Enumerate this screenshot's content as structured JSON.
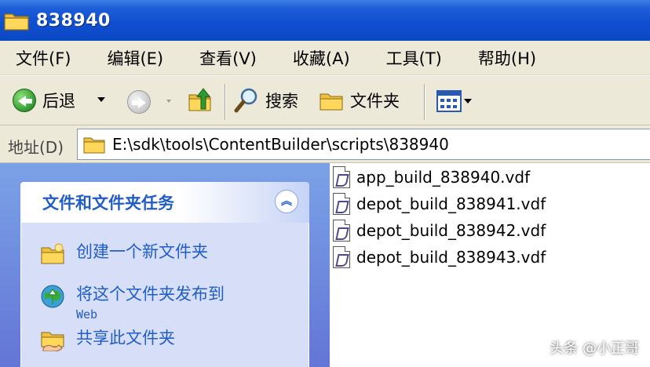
{
  "window": {
    "title": "838940"
  },
  "menu": [
    {
      "label": "文件(F)"
    },
    {
      "label": "编辑(E)"
    },
    {
      "label": "查看(V)"
    },
    {
      "label": "收藏(A)"
    },
    {
      "label": "工具(T)"
    },
    {
      "label": "帮助(H)"
    }
  ],
  "toolbar": {
    "back_label": "后退",
    "search_label": "搜索",
    "folders_label": "文件夹"
  },
  "address": {
    "label": "地址(D)",
    "path": "E:\\sdk\\tools\\ContentBuilder\\scripts\\838940"
  },
  "tasks": {
    "header": "文件和文件夹任务",
    "collapse_glyph": "︽",
    "items": [
      {
        "label": "创建一个新文件夹",
        "icon": "new-folder-icon"
      },
      {
        "label": "将这个文件夹发布到",
        "sub": "Web",
        "icon": "publish-web-icon"
      },
      {
        "label": "共享此文件夹",
        "icon": "share-folder-icon"
      }
    ]
  },
  "files": [
    {
      "name": "app_build_838940.vdf"
    },
    {
      "name": "depot_build_838941.vdf"
    },
    {
      "name": "depot_build_838942.vdf"
    },
    {
      "name": "depot_build_838943.vdf"
    }
  ],
  "watermark": "头条 @小正哥",
  "colors": {
    "titlebar": "#0b48c4",
    "chrome": "#ece9d8",
    "task_pane": "#6375d6",
    "task_link": "#215dc6"
  }
}
